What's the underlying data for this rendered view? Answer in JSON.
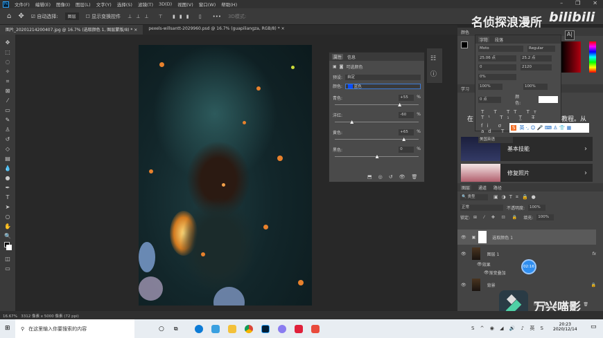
{
  "menu": [
    "文件(F)",
    "编辑(E)",
    "图像(I)",
    "图层(L)",
    "文字(Y)",
    "选择(S)",
    "滤镜(T)",
    "3D(D)",
    "视图(V)",
    "窗口(W)",
    "帮助(H)"
  ],
  "options": {
    "auto_select": "自动选择:",
    "auto_select_value": "图层",
    "show_transform": "显示变换控件",
    "mode_3d": "3D模式:"
  },
  "tabs": [
    "图片_20201214200407.jpg @ 16.7% (选取颜色 1, 图层蒙版/8) *",
    "pexels-willsantt-2029960.psd @ 16.7% (guapiliangza, RGB/8) *"
  ],
  "watermark": {
    "channel": "名侦探浪漫所",
    "site": "bilibili",
    "editor": "万兴喵影",
    "timer": "02:16"
  },
  "properties": {
    "tabs": [
      "属性",
      "信息"
    ],
    "title": "可选颜色",
    "preset_label": "预设:",
    "preset_value": "自定",
    "color_label": "颜色:",
    "color_value": "蓝色",
    "color_swatch": "#0a4dff",
    "sliders": [
      {
        "label": "青色:",
        "value": "+55",
        "pct": "%",
        "pos": 0.77
      },
      {
        "label": "洋红:",
        "value": "-60",
        "pct": "%",
        "pos": 0.2
      },
      {
        "label": "黄色:",
        "value": "+65",
        "pct": "%",
        "pos": 0.82
      },
      {
        "label": "黑色:",
        "value": "0",
        "pct": "%",
        "pos": 0.5
      }
    ]
  },
  "character": {
    "tabs": [
      "颜色",
      "字符",
      "段落"
    ],
    "font": "Moto",
    "style": "Regular",
    "size": "25.06 点",
    "leading": "25.2 点",
    "kerning": "0",
    "tracking": "2120",
    "scale_pct": "0%",
    "vscale": "100%",
    "hscale": "100%",
    "baseline": "0 点",
    "color_label": "颜色:",
    "language": "美国英语"
  },
  "learn": {
    "tab": "学习",
    "text_left": "在",
    "text_right": "教程。从",
    "cards": [
      "基本技能",
      "修复照片"
    ]
  },
  "layers": {
    "tabs": [
      "图层",
      "通道",
      "路径"
    ],
    "filter": "类型",
    "blend": "正常",
    "opacity_label": "不透明度:",
    "opacity": "100%",
    "lock_label": "锁定:",
    "fill_label": "填充:",
    "fill": "100%",
    "items": [
      {
        "name": "选取颜色 1"
      },
      {
        "name": "图层 1",
        "fx": "fx"
      },
      {
        "name": "效果"
      },
      {
        "name": "渐变叠加"
      },
      {
        "name": "背景"
      }
    ]
  },
  "status": {
    "zoom": "16.67%",
    "doc": "3312 像素 x 5000 像素 (72 ppi)"
  },
  "taskbar": {
    "search": "在这里输入你要搜索的内容",
    "time": "20:23",
    "date": "2020/12/14"
  }
}
